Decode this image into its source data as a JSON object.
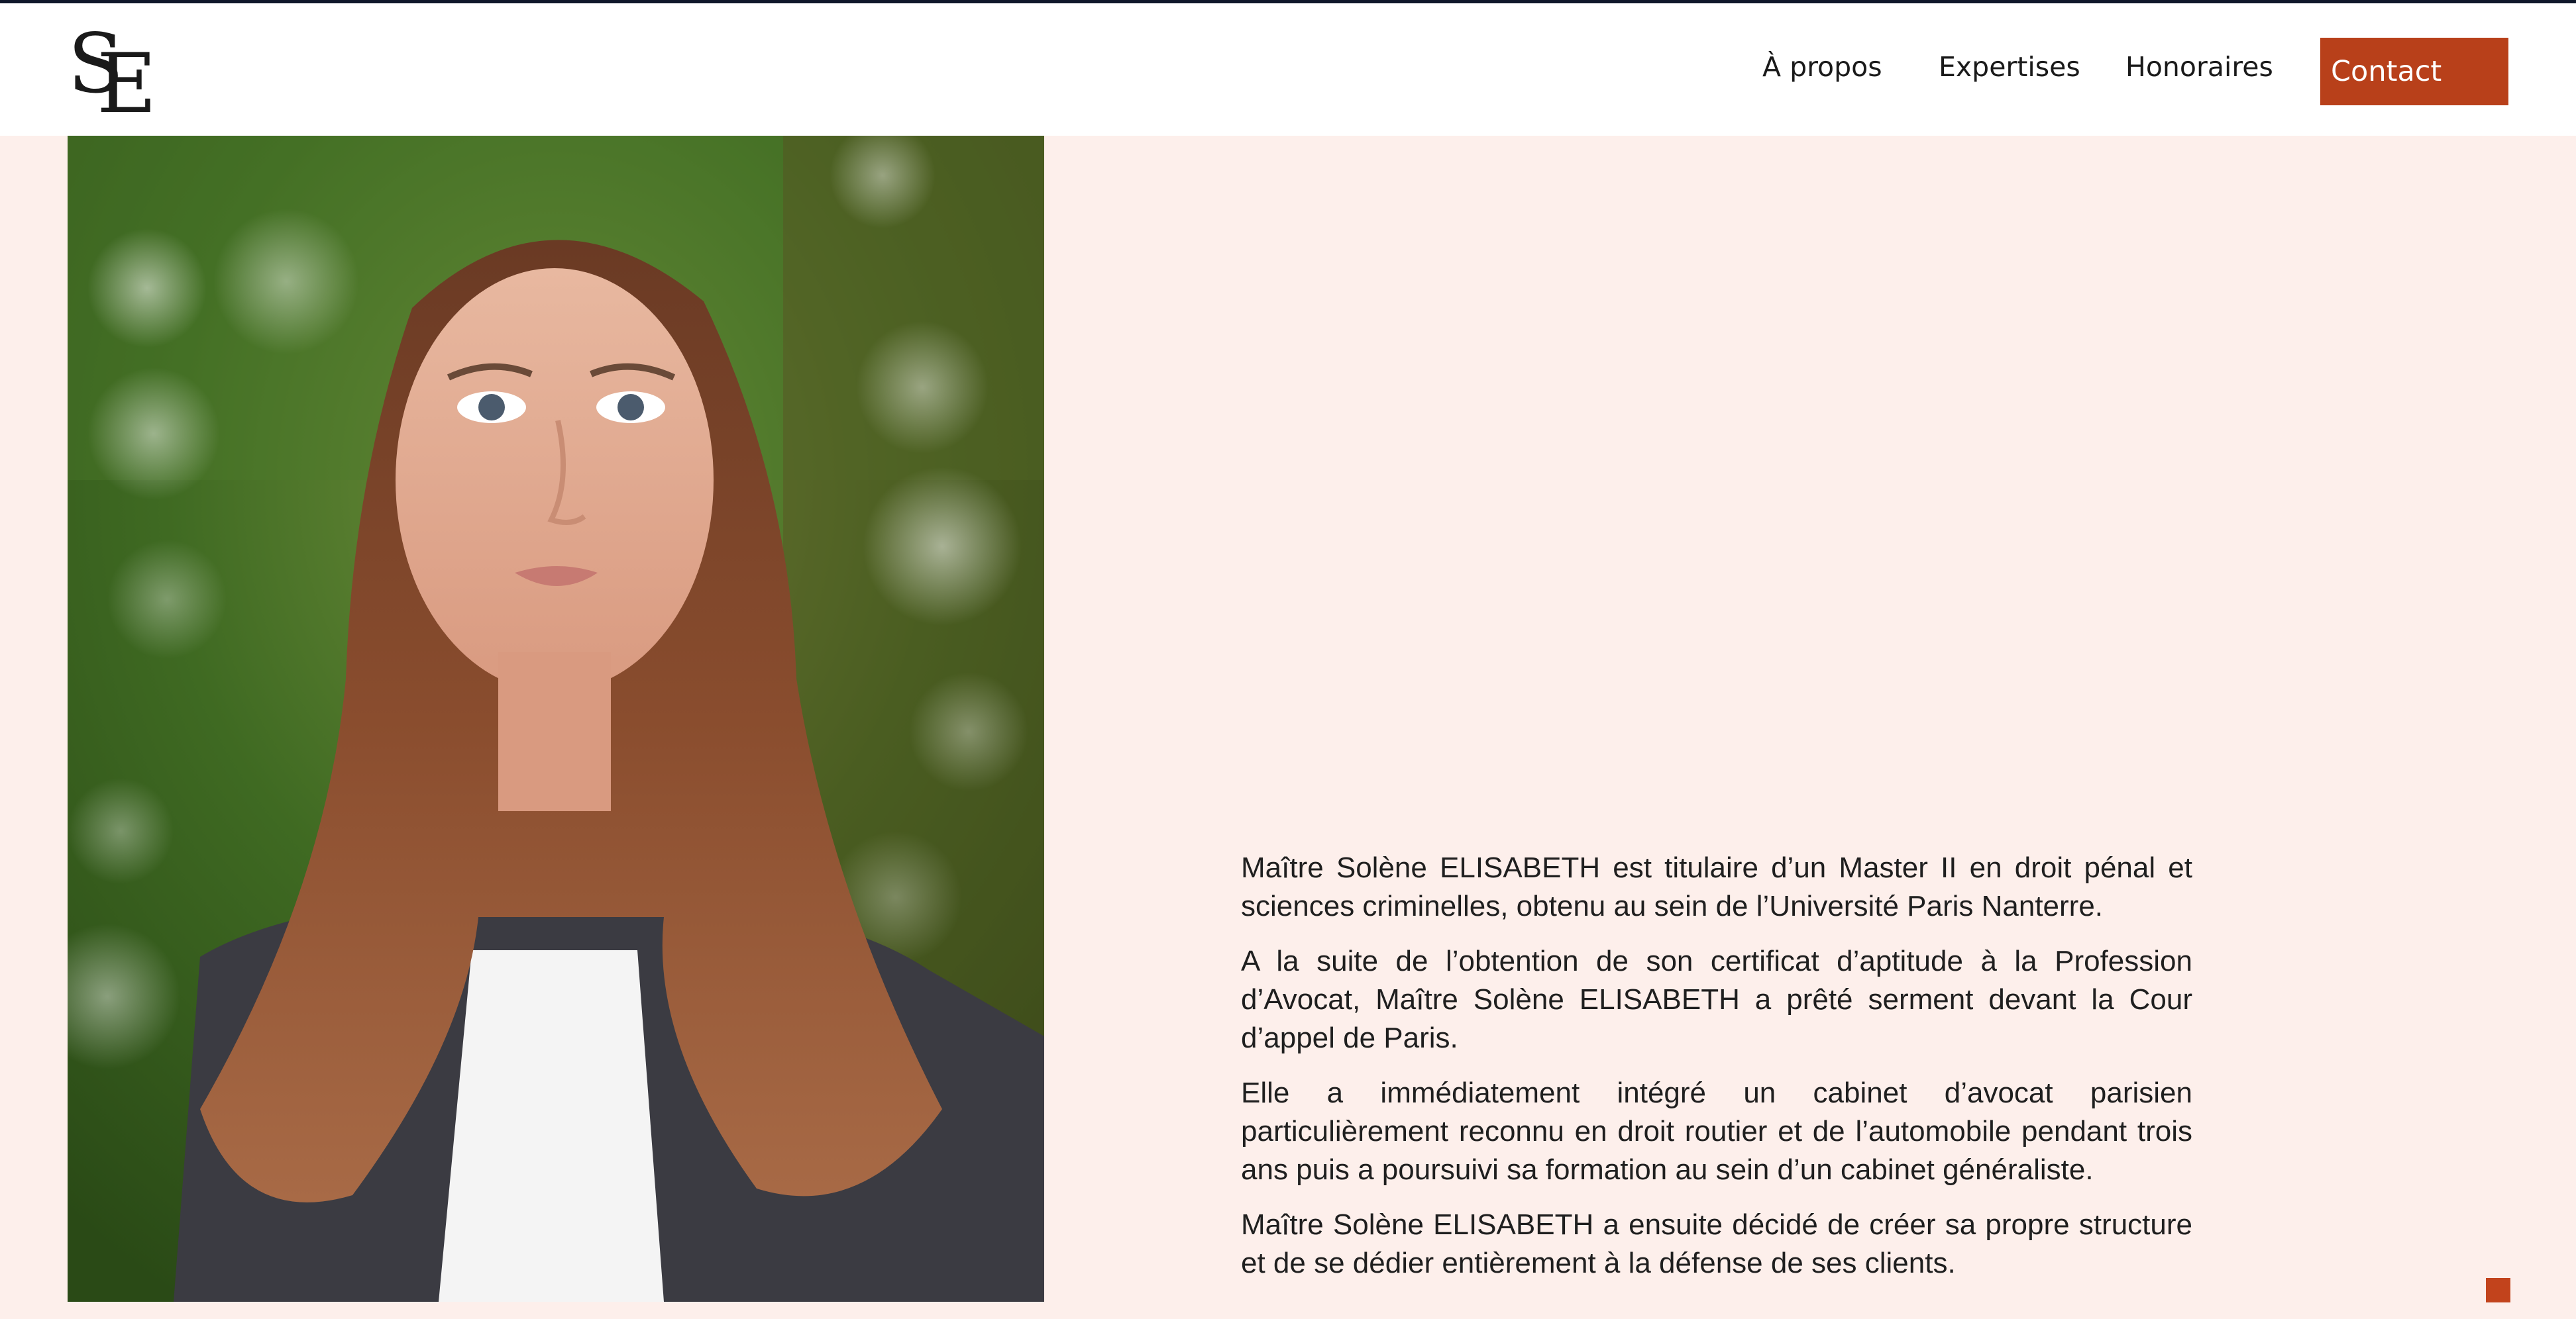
{
  "header": {
    "logo": {
      "letter_1": "S",
      "letter_2": "E"
    },
    "nav": [
      {
        "label": "À propos"
      },
      {
        "label": "Expertises"
      },
      {
        "label": "Honoraires"
      }
    ],
    "contact_label": "Contact"
  },
  "main": {
    "portrait": {
      "icon": "portrait-photo"
    },
    "bio": [
      "Maître Solène ELISABETH est titulaire d’un Master II en droit pénal et sciences criminelles, obtenu au sein de l’Université Paris Nanterre.",
      "A la suite de l’obtention de son certificat d’aptitude à la Profession d’Avocat, Maître Solène ELISABETH a prêté serment devant la Cour d’appel de Paris.",
      "Elle a immédiatement intégré un cabinet d’avocat parisien particulièrement reconnu en droit routier et de l’automobile pendant trois ans puis a poursuivi sa formation au sein d’un cabinet généraliste.",
      "Maître Solène ELISABETH a ensuite décidé de créer sa propre structure et de se dédier entièrement à la défense de ses clients."
    ]
  },
  "colors": {
    "accent": "#b8401a",
    "page_background": "#fdefeb",
    "header_background": "#ffffff",
    "top_border": "#0f172a"
  }
}
